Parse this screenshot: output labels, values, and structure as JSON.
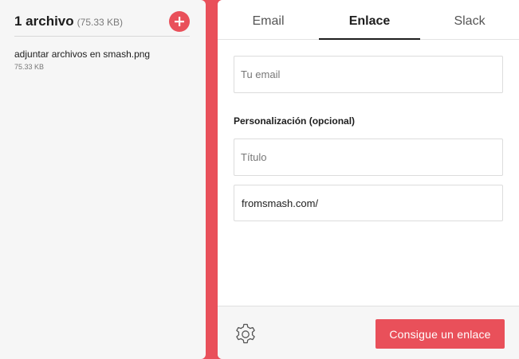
{
  "files": {
    "title": "1 archivo",
    "total_size": "(75.33 KB)",
    "add_icon": "plus-icon",
    "items": [
      {
        "name": "adjuntar archivos en smash.png",
        "size": "75.33 KB"
      }
    ]
  },
  "tabs": [
    {
      "label": "Email",
      "active": false
    },
    {
      "label": "Enlace",
      "active": true
    },
    {
      "label": "Slack",
      "active": false
    }
  ],
  "form": {
    "email_placeholder": "Tu email",
    "personalization_label": "Personalización (opcional)",
    "title_placeholder": "Título",
    "link_prefix": "fromsmash.com/"
  },
  "footer": {
    "settings_icon": "gear-icon",
    "submit_label": "Consigue un enlace"
  },
  "colors": {
    "accent": "#e9505a",
    "panel_background": "#f6f6f6"
  }
}
